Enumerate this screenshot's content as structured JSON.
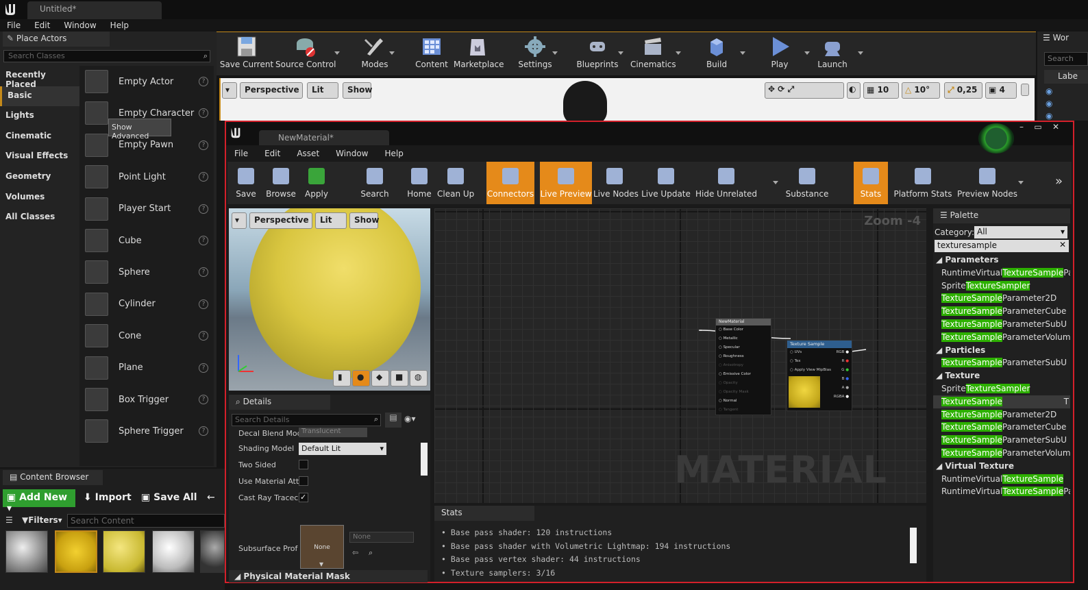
{
  "editor": {
    "tab_title": "Untitled*",
    "menu": [
      "File",
      "Edit",
      "Window",
      "Help"
    ]
  },
  "place_actors": {
    "tab_label": "Place Actors",
    "search_placeholder": "Search Classes",
    "categories": [
      "Recently Placed",
      "Basic",
      "Lights",
      "Cinematic",
      "Visual Effects",
      "Geometry",
      "Volumes",
      "All Classes"
    ],
    "selected_category": "Basic",
    "actors": [
      "Empty Actor",
      "Empty Character",
      "Empty Pawn",
      "Point Light",
      "Player Start",
      "Cube",
      "Sphere",
      "Cylinder",
      "Cone",
      "Plane",
      "Box Trigger",
      "Sphere Trigger"
    ],
    "tooltip": "Show Advanced"
  },
  "main_toolbar": [
    "Save Current",
    "Source Control",
    "Modes",
    "Content",
    "Marketplace",
    "Settings",
    "Blueprints",
    "Cinematics",
    "Build",
    "Play",
    "Launch"
  ],
  "viewport": {
    "perspective": "Perspective",
    "lit": "Lit",
    "show": "Show",
    "grid": "10",
    "angle": "10°",
    "scale": "0,25",
    "camera_speed": "4"
  },
  "right_panel": {
    "tab": "Wor",
    "search": "Search",
    "label": "Labe"
  },
  "material_editor": {
    "tab_title": "NewMaterial*",
    "menu": [
      "File",
      "Edit",
      "Asset",
      "Window",
      "Help"
    ],
    "toolbar": [
      "Save",
      "Browse",
      "Apply",
      "Search",
      "Home",
      "Clean Up",
      "Connectors",
      "Live Preview",
      "Live Nodes",
      "Live Update",
      "Hide Unrelated",
      "Substance",
      "Stats",
      "Platform Stats",
      "Preview Nodes"
    ],
    "active_tools": [
      "Connectors",
      "Live Preview",
      "Stats"
    ],
    "preview": {
      "perspective": "Perspective",
      "lit": "Lit",
      "show": "Show"
    },
    "graph": {
      "zoom": "Zoom -4",
      "watermark": "MATERIAL",
      "result_node": {
        "title": "NewMaterial",
        "pins": [
          "Base Color",
          "Metallic",
          "Specular",
          "Roughness",
          "Anisotropy",
          "Emissive Color",
          "Opacity",
          "Opacity Mask",
          "Normal",
          "Tangent"
        ]
      },
      "texture_node": {
        "title": "Texture Sample",
        "inputs": [
          "UVs",
          "Tex",
          "Apply View MipBias"
        ],
        "outputs": [
          "RGB",
          "R",
          "G",
          "B",
          "A",
          "RGBA"
        ]
      }
    },
    "details": {
      "tab": "Details",
      "search_placeholder": "Search Details",
      "rows": [
        {
          "label": "Decal Blend Mod",
          "value": "Translucent"
        },
        {
          "label": "Shading Model",
          "value": "Default Lit"
        },
        {
          "label": "Two Sided",
          "checked": false
        },
        {
          "label": "Use Material Att",
          "checked": false
        },
        {
          "label": "Cast Ray Tracec",
          "checked": true
        },
        {
          "label": "Subsurface Prof",
          "value": "None",
          "thumb_label": "None"
        }
      ],
      "section": "Physical Material Mask"
    },
    "stats": {
      "tab": "Stats",
      "lines": [
        "Base pass shader: 120 instructions",
        "Base pass shader with Volumetric Lightmap: 194 instructions",
        "Base pass vertex shader: 44 instructions",
        "Texture samplers: 3/16"
      ]
    },
    "palette": {
      "tab": "Palette",
      "category_label": "Category:",
      "category_value": "All",
      "search_value": "texturesample",
      "items": [
        {
          "type": "header",
          "text": "Parameters"
        },
        {
          "pre": "RuntimeVirtual",
          "hl": "TextureSample",
          "post": "Pa"
        },
        {
          "pre": "Sprite",
          "hl": "TextureSampler",
          "post": ""
        },
        {
          "pre": "",
          "hl": "TextureSample",
          "post": "Parameter2D"
        },
        {
          "pre": "",
          "hl": "TextureSample",
          "post": "ParameterCube"
        },
        {
          "pre": "",
          "hl": "TextureSample",
          "post": "ParameterSubU"
        },
        {
          "pre": "",
          "hl": "TextureSample",
          "post": "ParameterVolum"
        },
        {
          "type": "header",
          "text": "Particles"
        },
        {
          "pre": "",
          "hl": "TextureSample",
          "post": "ParameterSubU"
        },
        {
          "type": "header",
          "text": "Texture"
        },
        {
          "pre": "Sprite",
          "hl": "TextureSampler",
          "post": ""
        },
        {
          "pre": "",
          "hl": "TextureSample",
          "post": "",
          "selected": true,
          "trail": "T"
        },
        {
          "pre": "",
          "hl": "TextureSample",
          "post": "Parameter2D"
        },
        {
          "pre": "",
          "hl": "TextureSample",
          "post": "ParameterCube"
        },
        {
          "pre": "",
          "hl": "TextureSample",
          "post": "ParameterSubU"
        },
        {
          "pre": "",
          "hl": "TextureSample",
          "post": "ParameterVolum"
        },
        {
          "type": "header",
          "text": "Virtual Texture"
        },
        {
          "pre": "RuntimeVirtual",
          "hl": "TextureSample",
          "post": ""
        },
        {
          "pre": "RuntimeVirtual",
          "hl": "TextureSample",
          "post": "Pa"
        }
      ]
    }
  },
  "content_browser": {
    "tab": "Content Browser",
    "add_new": "Add New",
    "import": "Import",
    "save_all": "Save All",
    "filters": "Filters",
    "search_placeholder": "Search Content"
  },
  "colors": {
    "accent": "#c58a1a",
    "active_tool": "#e58a1a",
    "editor_border": "#d4202a",
    "highlight": "#2db000",
    "add_new": "#2f9e2f"
  }
}
